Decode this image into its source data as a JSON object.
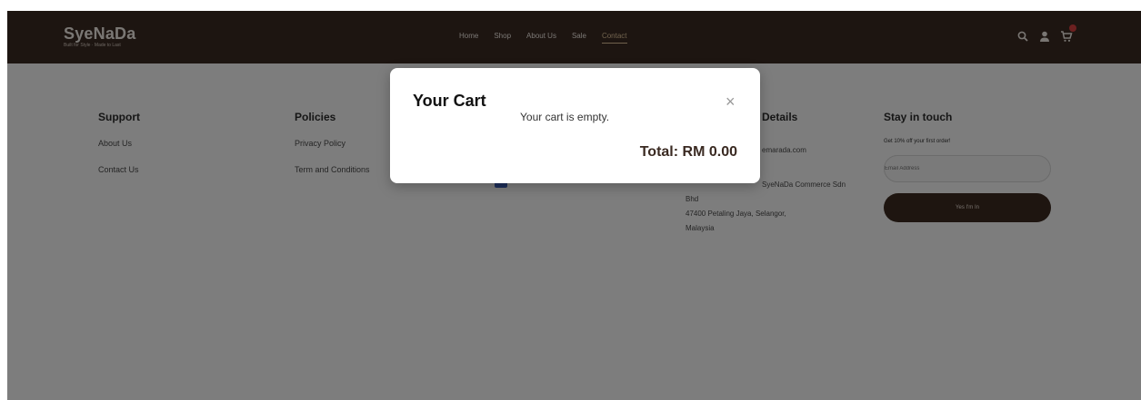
{
  "header": {
    "logo_title": "SyeNaDa",
    "logo_tagline": "Built for Style · Made to Last",
    "nav": [
      {
        "label": "Home"
      },
      {
        "label": "Shop"
      },
      {
        "label": "About Us"
      },
      {
        "label": "Sale"
      },
      {
        "label": "Contact"
      }
    ],
    "active_nav": "Contact",
    "icons": [
      "search-icon",
      "user-icon",
      "cart-icon"
    ],
    "background_color": "#3a2a22"
  },
  "footer": {
    "support": {
      "heading": "Support",
      "links": [
        "About Us",
        "Contact Us"
      ]
    },
    "policies": {
      "heading": "Policies",
      "links": [
        "Privacy Policy",
        "Term and Conditions"
      ]
    },
    "details": {
      "heading": "Details",
      "email": "emarada.com",
      "address_line1": "SyeNaDa Commerce Sdn",
      "address_line2": "Bhd",
      "address_line3": "47400 Petaling Jaya, Selangor,",
      "address_line4": "Malaysia"
    },
    "stay_in_touch": {
      "heading": "Stay in touch",
      "promo": "Get 10% off your first order!",
      "email_placeholder": "Email Address",
      "button_label": "Yes I'm In"
    }
  },
  "modal": {
    "title": "Your Cart",
    "close_symbol": "×",
    "empty_message": "Your cart is empty.",
    "total": "Total: RM 0.00"
  },
  "colors": {
    "brand_dark": "#3a2a22",
    "accent": "#e0c49a",
    "cart_badge": "#d84040",
    "overlay": "rgba(0,0,0,0.5)"
  }
}
